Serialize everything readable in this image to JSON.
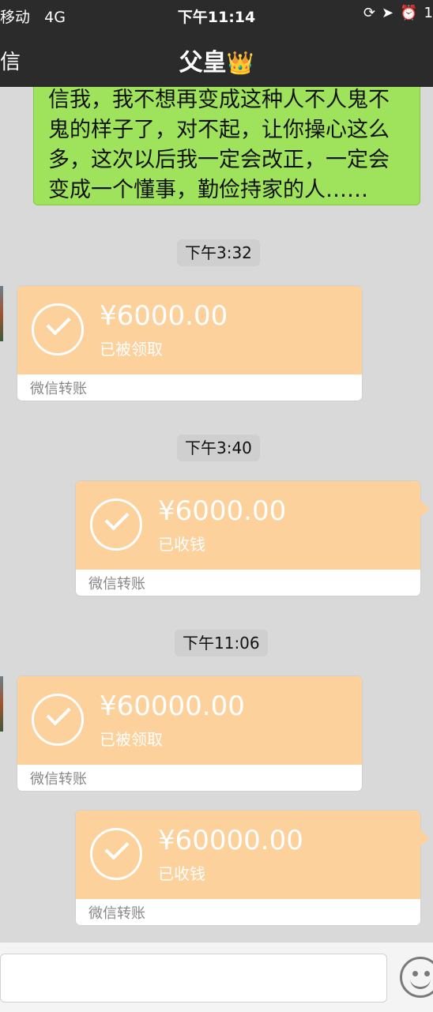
{
  "status_bar": {
    "carrier": "移动",
    "network": "4G",
    "time": "下午11:14",
    "battery_partial": "1"
  },
  "nav": {
    "back_label": "信",
    "title": "父皇",
    "title_emoji": "👑"
  },
  "messages": {
    "green_text": "信我，我不想再变成这种人不人鬼不鬼的样子了，对不起，让你操心这么多，这次以后我一定会改正，一定会变成一个懂事，勤俭持家的人……",
    "ts1": "下午3:32",
    "t1_amount": "¥6000.00",
    "t1_status": "已被领取",
    "t1_footer": "微信转账",
    "ts2": "下午3:40",
    "t2_amount": "¥6000.00",
    "t2_status": "已收钱",
    "t2_footer": "微信转账",
    "ts3": "下午11:06",
    "t3_amount": "¥60000.00",
    "t3_status": "已被领取",
    "t3_footer": "微信转账",
    "t4_amount": "¥60000.00",
    "t4_status": "已收钱",
    "t4_footer": "微信转账"
  },
  "colors": {
    "topbar": "#2b2b2b",
    "bubble_green": "#9fe25b",
    "transfer_orange": "#fdd19b",
    "background": "#d9d9d9"
  }
}
